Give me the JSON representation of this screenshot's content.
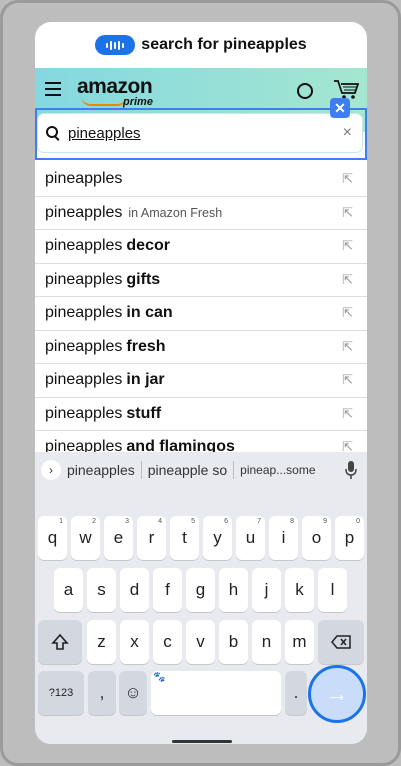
{
  "banner": {
    "text": "search for pineapples"
  },
  "header": {
    "logo_text": "amazon",
    "logo_sub": "prime"
  },
  "search": {
    "value": "pineapples",
    "clear": "×"
  },
  "suggestions": [
    {
      "base": "pineapples",
      "bold": "",
      "dept": ""
    },
    {
      "base": "pineapples",
      "bold": "",
      "dept": "in Amazon Fresh"
    },
    {
      "base": "pineapples",
      "bold": "decor",
      "dept": ""
    },
    {
      "base": "pineapples",
      "bold": "gifts",
      "dept": ""
    },
    {
      "base": "pineapples",
      "bold": "in can",
      "dept": ""
    },
    {
      "base": "pineapples",
      "bold": "fresh",
      "dept": ""
    },
    {
      "base": "pineapples",
      "bold": "in jar",
      "dept": ""
    },
    {
      "base": "pineapples",
      "bold": "stuff",
      "dept": ""
    },
    {
      "base": "pineapples",
      "bold": "and flamingos",
      "dept": ""
    }
  ],
  "keyboard": {
    "suggestions": [
      "pineapples",
      "pineapple so",
      "pineap...some"
    ],
    "row1": [
      "q",
      "w",
      "e",
      "r",
      "t",
      "y",
      "u",
      "i",
      "o",
      "p"
    ],
    "row1_nums": [
      "1",
      "2",
      "3",
      "4",
      "5",
      "6",
      "7",
      "8",
      "9",
      "0"
    ],
    "row2": [
      "a",
      "s",
      "d",
      "f",
      "g",
      "h",
      "j",
      "k",
      "l"
    ],
    "row3": [
      "z",
      "x",
      "c",
      "v",
      "b",
      "n",
      "m"
    ],
    "symbols": "?123",
    "comma": ",",
    "emoji": "☺",
    "period": ".",
    "enter": "→"
  },
  "nav": {
    "chevron": "⌄"
  }
}
